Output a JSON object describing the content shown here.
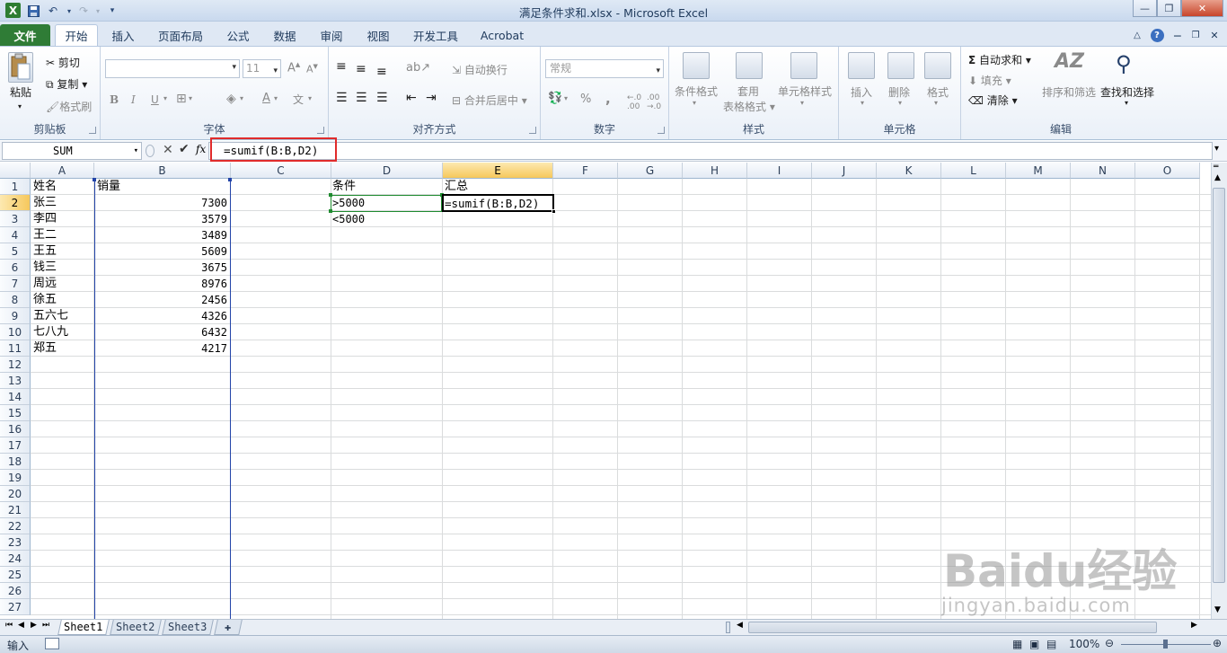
{
  "window": {
    "title": "满足条件求和.xlsx - Microsoft Excel"
  },
  "tabs": [
    "文件",
    "开始",
    "插入",
    "页面布局",
    "公式",
    "数据",
    "审阅",
    "视图",
    "开发工具",
    "Acrobat"
  ],
  "ribbon": {
    "clipboard": {
      "label": "剪贴板",
      "paste": "粘贴",
      "cut": "剪切",
      "copy": "复制",
      "format_painter": "格式刷"
    },
    "font": {
      "label": "字体",
      "size": "11",
      "bold": "B",
      "italic": "I",
      "underline": "U"
    },
    "alignment": {
      "label": "对齐方式",
      "wrap": "自动换行",
      "merge": "合并后居中"
    },
    "number": {
      "label": "数字",
      "format": "常规",
      "percent": "%",
      "comma": ","
    },
    "styles": {
      "label": "样式",
      "conditional": "条件格式",
      "table_1": "套用",
      "table_2": "表格格式",
      "cell_styles": "单元格样式"
    },
    "cells": {
      "label": "单元格",
      "insert": "插入",
      "delete": "删除",
      "format": "格式"
    },
    "editing": {
      "label": "编辑",
      "autosum": "自动求和",
      "fill": "填充",
      "clear": "清除",
      "sort": "排序和筛选",
      "find": "查找和选择"
    }
  },
  "formula_bar": {
    "name_box": "SUM",
    "formula": "=sumif(B:B,D2)",
    "formula_prefix": "=sumif(B:B,",
    "formula_ref": "D2",
    "formula_suffix": ")"
  },
  "columns": [
    "A",
    "B",
    "C",
    "D",
    "E",
    "F",
    "G",
    "H",
    "I",
    "J",
    "K",
    "L",
    "M",
    "N",
    "O"
  ],
  "rows": [
    "1",
    "2",
    "3",
    "4",
    "5",
    "6",
    "7",
    "8",
    "9",
    "10",
    "11",
    "12",
    "13",
    "14",
    "15",
    "16",
    "17",
    "18",
    "19",
    "20",
    "21",
    "22",
    "23",
    "24",
    "25",
    "26",
    "27"
  ],
  "cells": {
    "A": [
      "姓名",
      "张三",
      "李四",
      "王二",
      "王五",
      "钱三",
      "周远",
      "徐五",
      "五六七",
      "七八九",
      "郑五"
    ],
    "B": [
      "销量",
      "7300",
      "3579",
      "3489",
      "5609",
      "3675",
      "8976",
      "2456",
      "4326",
      "6432",
      "4217"
    ],
    "D": [
      "条件",
      ">5000",
      "<5000"
    ],
    "E1": "汇总",
    "E2": "=sumif(B:B,D2)"
  },
  "sheets": [
    "Sheet1",
    "Sheet2",
    "Sheet3"
  ],
  "status": {
    "mode": "输入",
    "zoom": "100%"
  },
  "watermark": {
    "brand": "Baidu经验",
    "url": "jingyan.baidu.com"
  }
}
